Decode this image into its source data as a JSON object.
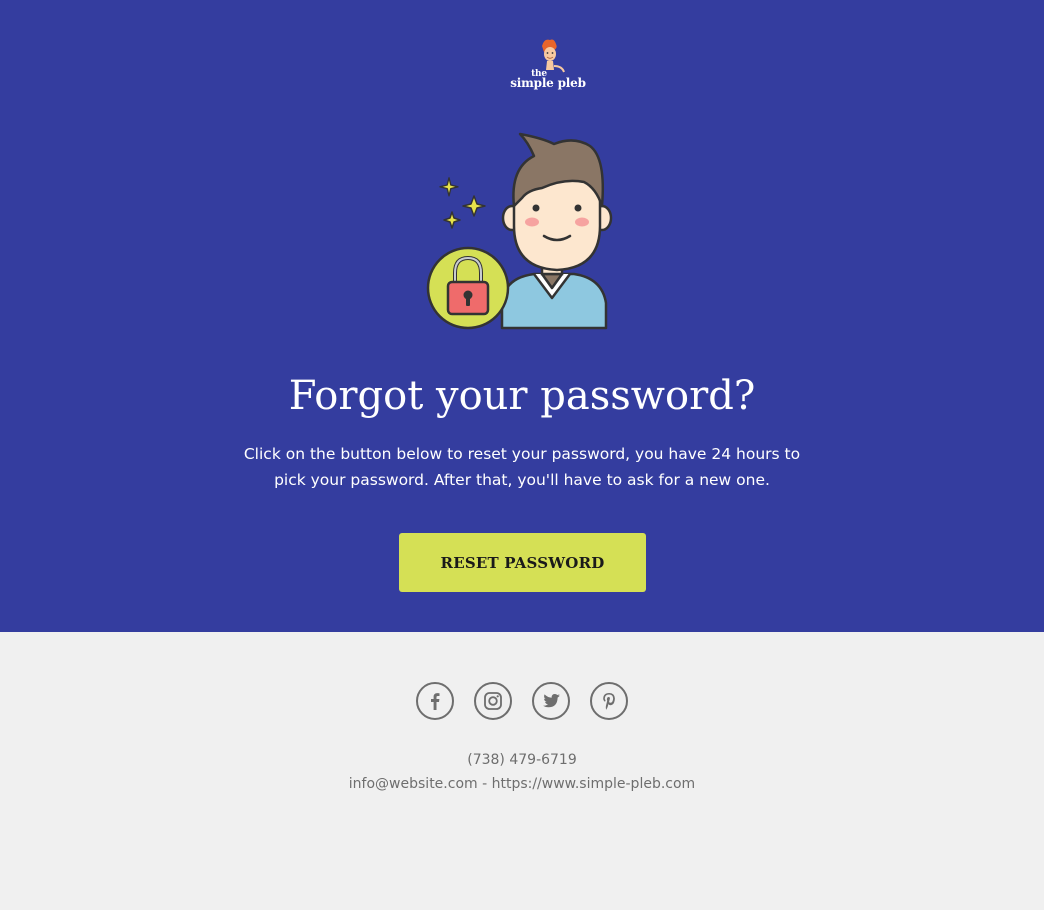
{
  "logo": {
    "line1": "the",
    "line2": "simple pleb"
  },
  "hero": {
    "title": "Forgot your password?",
    "description": "Click on the button below to reset your password, you have 24 hours to pick your password. After that, you'll have to ask for a new one.",
    "button_label": "RESET PASSWORD",
    "illustration_icon": "user-with-lock-icon"
  },
  "footer": {
    "socials": [
      {
        "name": "facebook",
        "icon": "facebook-icon"
      },
      {
        "name": "instagram",
        "icon": "instagram-icon"
      },
      {
        "name": "twitter",
        "icon": "twitter-icon"
      },
      {
        "name": "pinterest",
        "icon": "pinterest-icon"
      }
    ],
    "phone": "(738) 479-6719",
    "email": "info@website.com",
    "separator": " - ",
    "website": "https://www.simple-pleb.com"
  },
  "colors": {
    "hero_bg": "#343d9f",
    "button_bg": "#d5e055",
    "footer_bg": "#f0f0f0",
    "footer_text": "#6e6e6e"
  }
}
